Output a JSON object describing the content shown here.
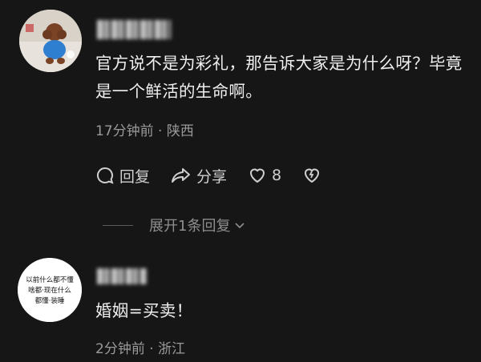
{
  "comments": [
    {
      "text": "官方说不是为彩礼，那告诉大家是为什么呀？毕竟是一个鲜活的生命啊。",
      "meta": "17分钟前 · 陕西",
      "actions": {
        "reply": "回复",
        "share": "分享",
        "likes": "8"
      },
      "expand_replies": "展开1条回复"
    },
    {
      "avatar_text": "以前什么都不懂 啥都·现在什么 都懂·装睡",
      "text": "婚姻=买卖！",
      "meta": "2分钟前 · 浙江"
    }
  ],
  "colors": {
    "background": "#161616",
    "text": "#efefef",
    "secondary": "#9a9a9a"
  },
  "icons": [
    "reply-icon",
    "share-icon",
    "like-heart-icon",
    "dislike-broken-heart-icon",
    "chevron-down-icon"
  ]
}
